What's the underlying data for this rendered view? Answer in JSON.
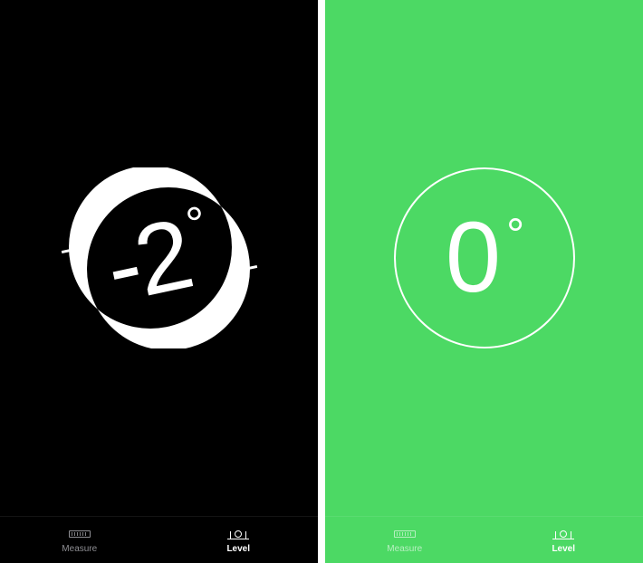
{
  "colors": {
    "unlevel_bg": "#000000",
    "level_bg": "#4cd964",
    "foreground": "#ffffff",
    "tab_inactive": "#8e8e93"
  },
  "screens": [
    {
      "id": "unlevel",
      "angle_value": "-2",
      "angle_unit": "°",
      "tilt_deg": -12,
      "tabs": {
        "measure": {
          "label": "Measure",
          "active": false,
          "icon": "ruler-icon"
        },
        "level": {
          "label": "Level",
          "active": true,
          "icon": "level-icon"
        }
      }
    },
    {
      "id": "level",
      "angle_value": "0",
      "angle_unit": "°",
      "tilt_deg": 0,
      "tabs": {
        "measure": {
          "label": "Measure",
          "active": false,
          "icon": "ruler-icon"
        },
        "level": {
          "label": "Level",
          "active": true,
          "icon": "level-icon"
        }
      }
    }
  ]
}
